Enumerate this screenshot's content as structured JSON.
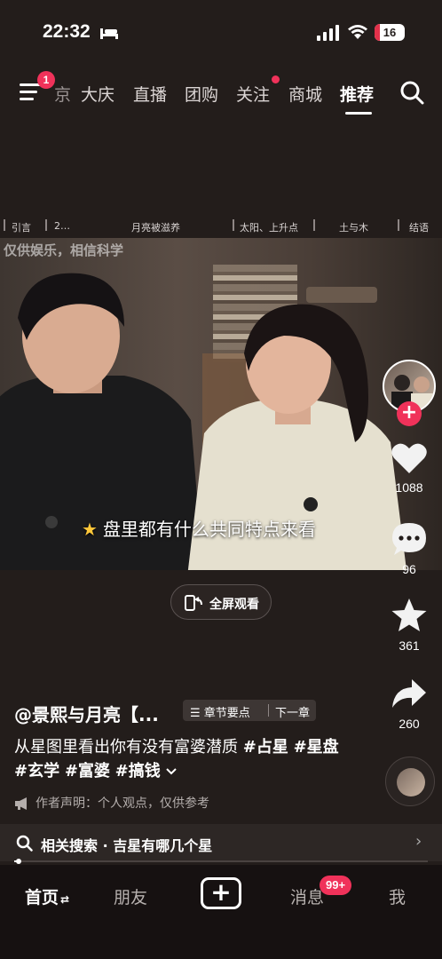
{
  "status_bar": {
    "time": "22:32",
    "battery": "16"
  },
  "topnav": {
    "menu_badge": "1",
    "partial_tab": "京",
    "tabs": [
      {
        "label": "大庆"
      },
      {
        "label": "直播"
      },
      {
        "label": "团购"
      },
      {
        "label": "关注"
      },
      {
        "label": "商城"
      },
      {
        "label": "推荐"
      }
    ],
    "active_tab": "推荐"
  },
  "chapters": [
    "引言",
    "2…",
    "月亮被滋养",
    "太阳、上升点",
    "土与木",
    "结语"
  ],
  "video": {
    "watermark": "仅供娱乐，相信科学",
    "subtitle": "盘里都有什么共同特点来看",
    "fullscreen_label": "全屏观看"
  },
  "rail": {
    "likes": "1088",
    "comments": "96",
    "favorites": "361",
    "shares": "260"
  },
  "caption": {
    "author": "@景熙与月亮【...",
    "chapter_key": "章节要点",
    "next_chapter": "下一章",
    "desc_text": "从星图里看出你有没有富婆潜质 ",
    "tags": [
      "#占星",
      "#星盘",
      "#玄学",
      "#富婆",
      "#搞钱"
    ],
    "disclaimer": "作者声明：个人观点，仅供参考"
  },
  "related": {
    "label": "相关搜索",
    "dot": "·",
    "query": "吉星有哪几个星"
  },
  "progress": {
    "fraction": 0.01
  },
  "tabbar": {
    "home": "首页",
    "friends": "朋友",
    "messages": "消息",
    "messages_badge": "99+",
    "me": "我"
  },
  "colors": {
    "accent": "#f0325a",
    "background": "#231d1b",
    "tabbar": "#161111"
  }
}
